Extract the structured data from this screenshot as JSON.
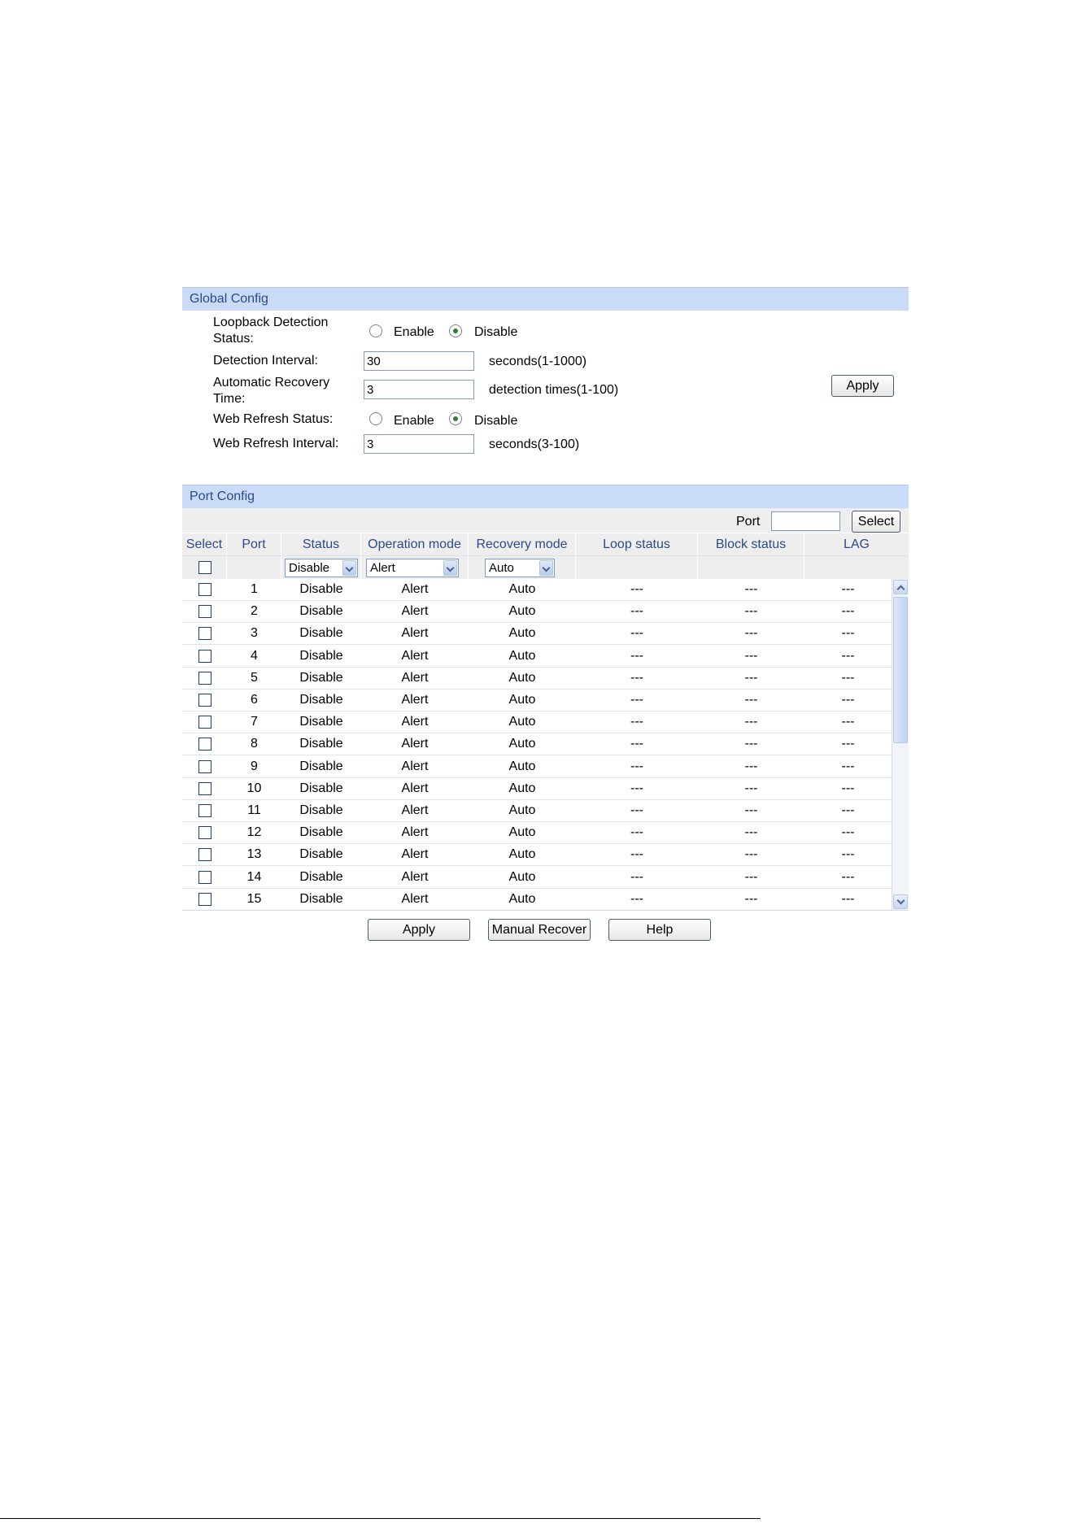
{
  "global": {
    "title": "Global Config",
    "loopback_label_1": "Loopback Detection",
    "loopback_label_2": "Status:",
    "enable": "Enable",
    "disable": "Disable",
    "loopback_selected": "Disable",
    "interval_label": "Detection Interval:",
    "interval_value": "30",
    "interval_hint": "seconds(1-1000)",
    "recovery_label_1": "Automatic Recovery",
    "recovery_label_2": "Time:",
    "recovery_value": "3",
    "recovery_hint": "detection times(1-100)",
    "web_refresh_label": "Web Refresh Status:",
    "web_refresh_selected": "Disable",
    "web_interval_label": "Web Refresh Interval:",
    "web_interval_value": "3",
    "web_interval_hint": "seconds(3-100)",
    "apply": "Apply"
  },
  "port_config": {
    "title": "Port Config",
    "port_label": "Port",
    "port_value": "",
    "select_button": "Select",
    "headers": [
      "Select",
      "Port",
      "Status",
      "Operation mode",
      "Recovery mode",
      "Loop status",
      "Block status",
      "LAG"
    ],
    "filter": {
      "status": "Disable",
      "operation": "Alert",
      "recovery": "Auto"
    },
    "rows": [
      {
        "port": "1",
        "status": "Disable",
        "operation": "Alert",
        "recovery": "Auto",
        "loop": "---",
        "block": "---",
        "lag": "---"
      },
      {
        "port": "2",
        "status": "Disable",
        "operation": "Alert",
        "recovery": "Auto",
        "loop": "---",
        "block": "---",
        "lag": "---"
      },
      {
        "port": "3",
        "status": "Disable",
        "operation": "Alert",
        "recovery": "Auto",
        "loop": "---",
        "block": "---",
        "lag": "---"
      },
      {
        "port": "4",
        "status": "Disable",
        "operation": "Alert",
        "recovery": "Auto",
        "loop": "---",
        "block": "---",
        "lag": "---"
      },
      {
        "port": "5",
        "status": "Disable",
        "operation": "Alert",
        "recovery": "Auto",
        "loop": "---",
        "block": "---",
        "lag": "---"
      },
      {
        "port": "6",
        "status": "Disable",
        "operation": "Alert",
        "recovery": "Auto",
        "loop": "---",
        "block": "---",
        "lag": "---"
      },
      {
        "port": "7",
        "status": "Disable",
        "operation": "Alert",
        "recovery": "Auto",
        "loop": "---",
        "block": "---",
        "lag": "---"
      },
      {
        "port": "8",
        "status": "Disable",
        "operation": "Alert",
        "recovery": "Auto",
        "loop": "---",
        "block": "---",
        "lag": "---"
      },
      {
        "port": "9",
        "status": "Disable",
        "operation": "Alert",
        "recovery": "Auto",
        "loop": "---",
        "block": "---",
        "lag": "---"
      },
      {
        "port": "10",
        "status": "Disable",
        "operation": "Alert",
        "recovery": "Auto",
        "loop": "---",
        "block": "---",
        "lag": "---"
      },
      {
        "port": "11",
        "status": "Disable",
        "operation": "Alert",
        "recovery": "Auto",
        "loop": "---",
        "block": "---",
        "lag": "---"
      },
      {
        "port": "12",
        "status": "Disable",
        "operation": "Alert",
        "recovery": "Auto",
        "loop": "---",
        "block": "---",
        "lag": "---"
      },
      {
        "port": "13",
        "status": "Disable",
        "operation": "Alert",
        "recovery": "Auto",
        "loop": "---",
        "block": "---",
        "lag": "---"
      },
      {
        "port": "14",
        "status": "Disable",
        "operation": "Alert",
        "recovery": "Auto",
        "loop": "---",
        "block": "---",
        "lag": "---"
      },
      {
        "port": "15",
        "status": "Disable",
        "operation": "Alert",
        "recovery": "Auto",
        "loop": "---",
        "block": "---",
        "lag": "---"
      }
    ],
    "buttons": {
      "apply": "Apply",
      "manual_recover": "Manual Recover",
      "help": "Help"
    }
  },
  "colors": {
    "header_bg": "#c9dbf7",
    "header_text": "#2c4a86",
    "radio_checked": "#2e7d32"
  }
}
